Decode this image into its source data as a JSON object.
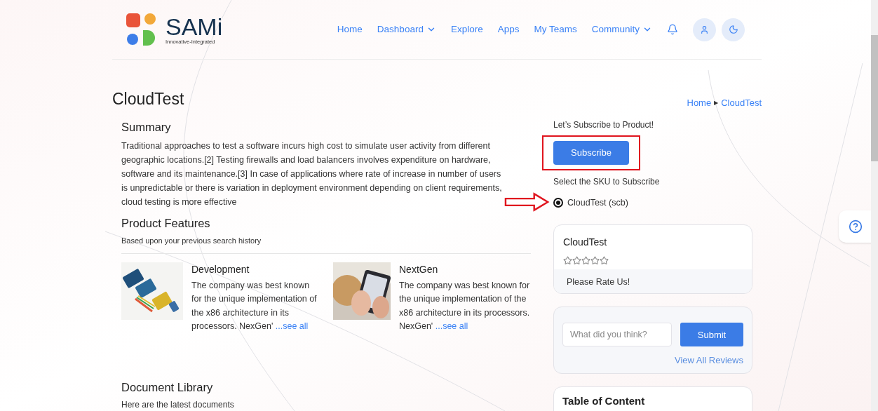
{
  "header": {
    "logo": {
      "name": "SAMi",
      "tagline": "Innovative-Integrated"
    },
    "nav": [
      {
        "label": "Home",
        "dropdown": false
      },
      {
        "label": "Dashboard",
        "dropdown": true
      },
      {
        "label": "Explore",
        "dropdown": false
      },
      {
        "label": "Apps",
        "dropdown": false
      },
      {
        "label": "My Teams",
        "dropdown": false
      },
      {
        "label": "Community",
        "dropdown": true
      }
    ]
  },
  "page_title": "CloudTest",
  "breadcrumb": {
    "separator": "▶",
    "items": [
      "Home",
      "CloudTest"
    ]
  },
  "summary": {
    "heading": "Summary",
    "text": "Traditional approaches to test a software incurs high cost to simulate user activity from different geographic locations.[2] Testing firewalls and load balancers involves expenditure on hardware, software and its maintenance.[3] In case of applications where rate of increase in number of users is unpredictable or there is variation in deployment environment depending on client requirements, cloud testing is more effective"
  },
  "product_features": {
    "heading": "Product Features",
    "subtitle": "Based upon your previous search history",
    "items": [
      {
        "title": "Development",
        "text": "The company was best known for the unique implementation of the x86 architecture in its processors. NexGen'",
        "link": "...see all",
        "kind": "picture"
      },
      {
        "title": "NextGen",
        "text": "The company was best known for the unique implementation of the x86 architecture in its processors. NexGen'",
        "link": "...see all",
        "kind": "picture"
      }
    ]
  },
  "document_library": {
    "heading": "Document Library",
    "subtitle": "Here are the latest documents"
  },
  "subscribe": {
    "prompt": "Let’s Subscribe to Product!",
    "button": "Subscribe",
    "highlighted": true,
    "sku_label": "Select the SKU to Subscribe",
    "skus": [
      {
        "label": "CloudTest (scb)",
        "selected": true,
        "pointed": true
      }
    ]
  },
  "rating_card": {
    "title": "CloudTest",
    "stars": 0,
    "prompt": "Please Rate Us!"
  },
  "review_card": {
    "placeholder": "What did you think?",
    "button": "Submit",
    "link": "View All Reviews"
  },
  "toc_card": {
    "title": "Table of Content"
  }
}
